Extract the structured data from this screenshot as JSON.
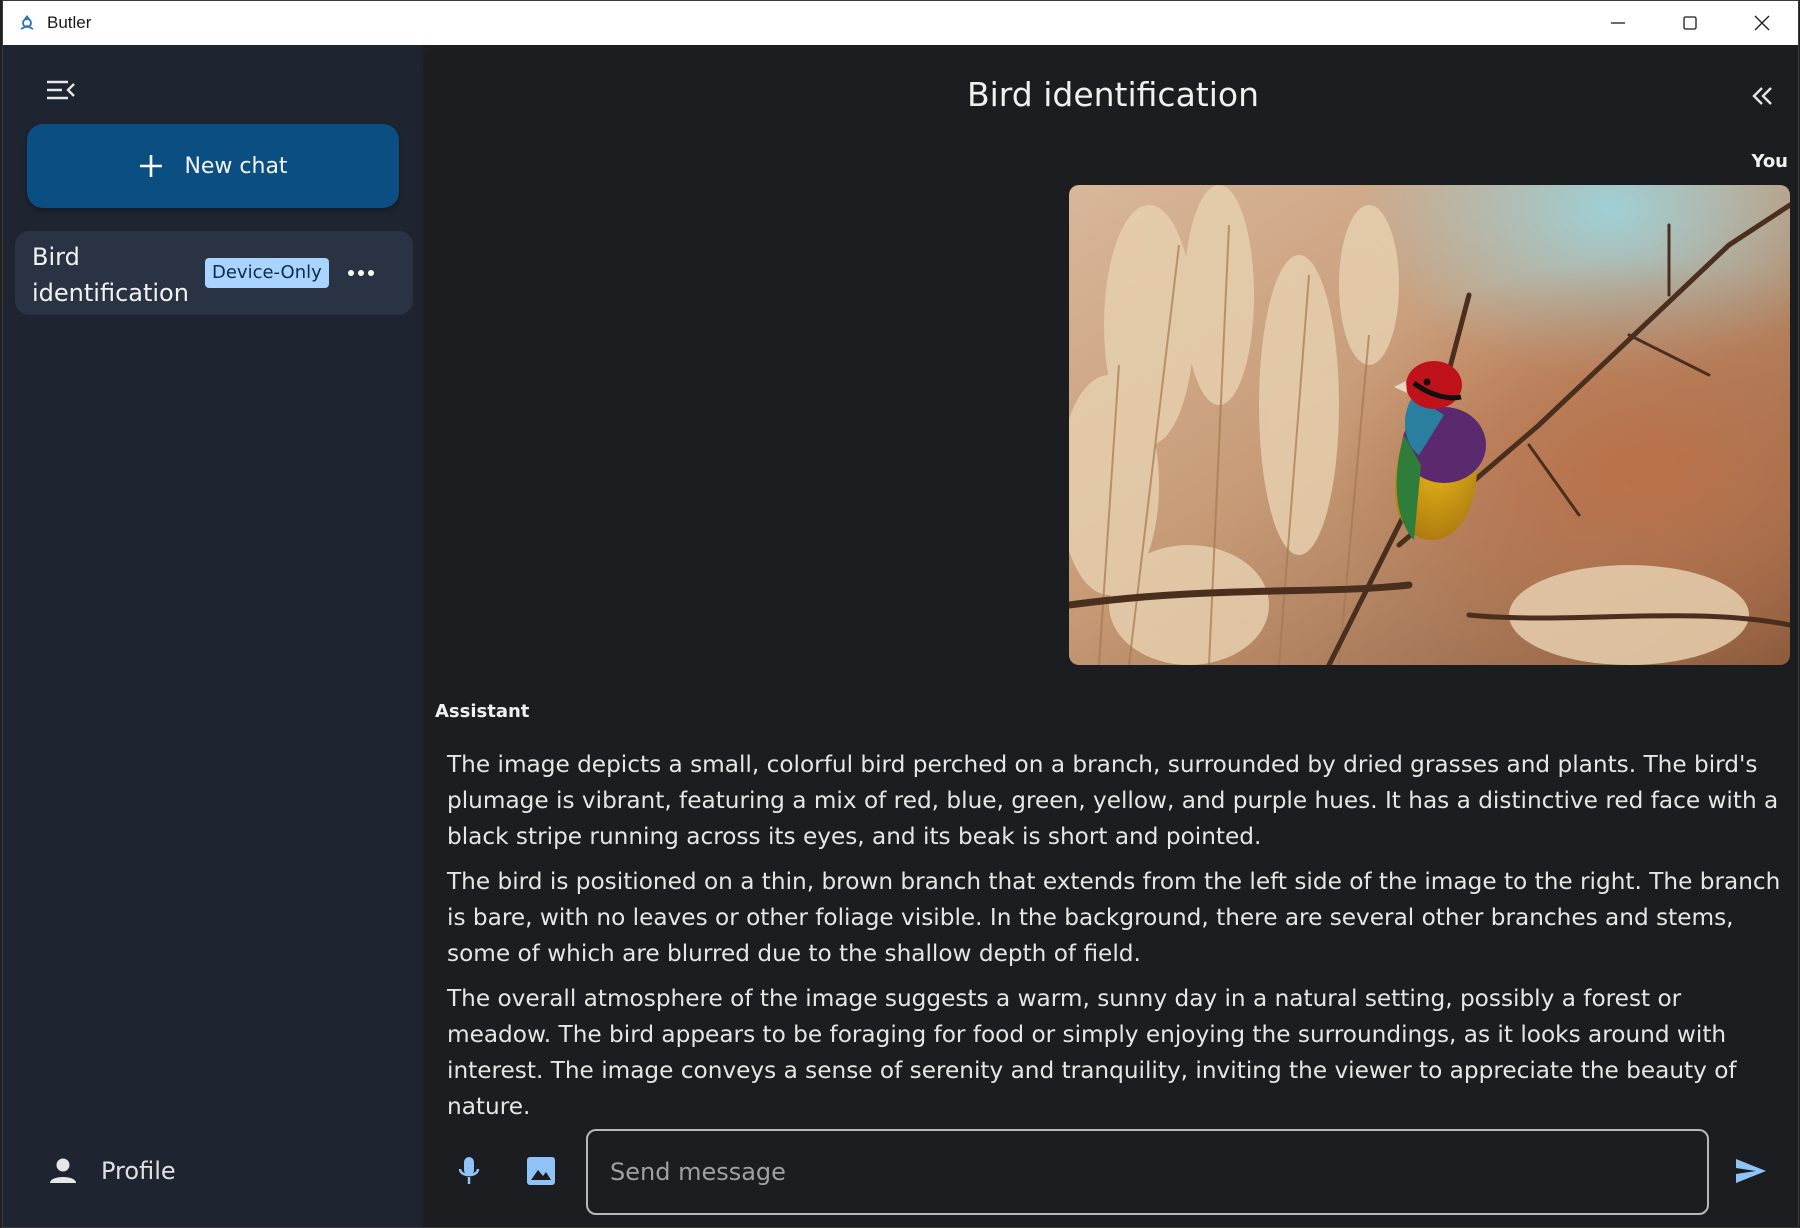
{
  "window": {
    "title": "Butler"
  },
  "sidebar": {
    "new_chat_label": "New chat",
    "chats": [
      {
        "title": "Bird identification",
        "badge": "Device-Only"
      }
    ],
    "profile_label": "Profile"
  },
  "conversation": {
    "title": "Bird identification",
    "user_label": "You",
    "assistant_label": "Assistant",
    "assistant_paragraphs": [
      "The image depicts a small, colorful bird perched on a branch, surrounded by dried grasses and plants. The bird's plumage is vibrant, featuring a mix of red, blue, green, yellow, and purple hues. It has a distinctive red face with a black stripe running across its eyes, and its beak is short and pointed.",
      "The bird is positioned on a thin, brown branch that extends from the left side of the image to the right. The branch is bare, with no leaves or other foliage visible. In the background, there are several other branches and stems, some of which are blurred due to the shallow depth of field.",
      "The overall atmosphere of the image suggests a warm, sunny day in a natural setting, possibly a forest or meadow. The bird appears to be foraging for food or simply enjoying the surroundings, as it looks around with interest. The image conveys a sense of serenity and tranquility, inviting the viewer to appreciate the beauty of nature."
    ]
  },
  "composer": {
    "placeholder": "Send message"
  },
  "icons": {
    "menu": "menu-collapse-icon",
    "new_chat": "plus-icon",
    "more": "more-horizontal-icon",
    "profile": "person-icon",
    "collapse": "double-chevron-left-icon",
    "mic": "microphone-icon",
    "image": "image-icon",
    "send": "send-icon"
  },
  "colors": {
    "accent": "#0b4f82",
    "badge_bg": "#a9d4ff",
    "icon_blue": "#8fc3f7",
    "sidebar_bg": "#1e2430",
    "main_bg": "#1c1d20"
  }
}
